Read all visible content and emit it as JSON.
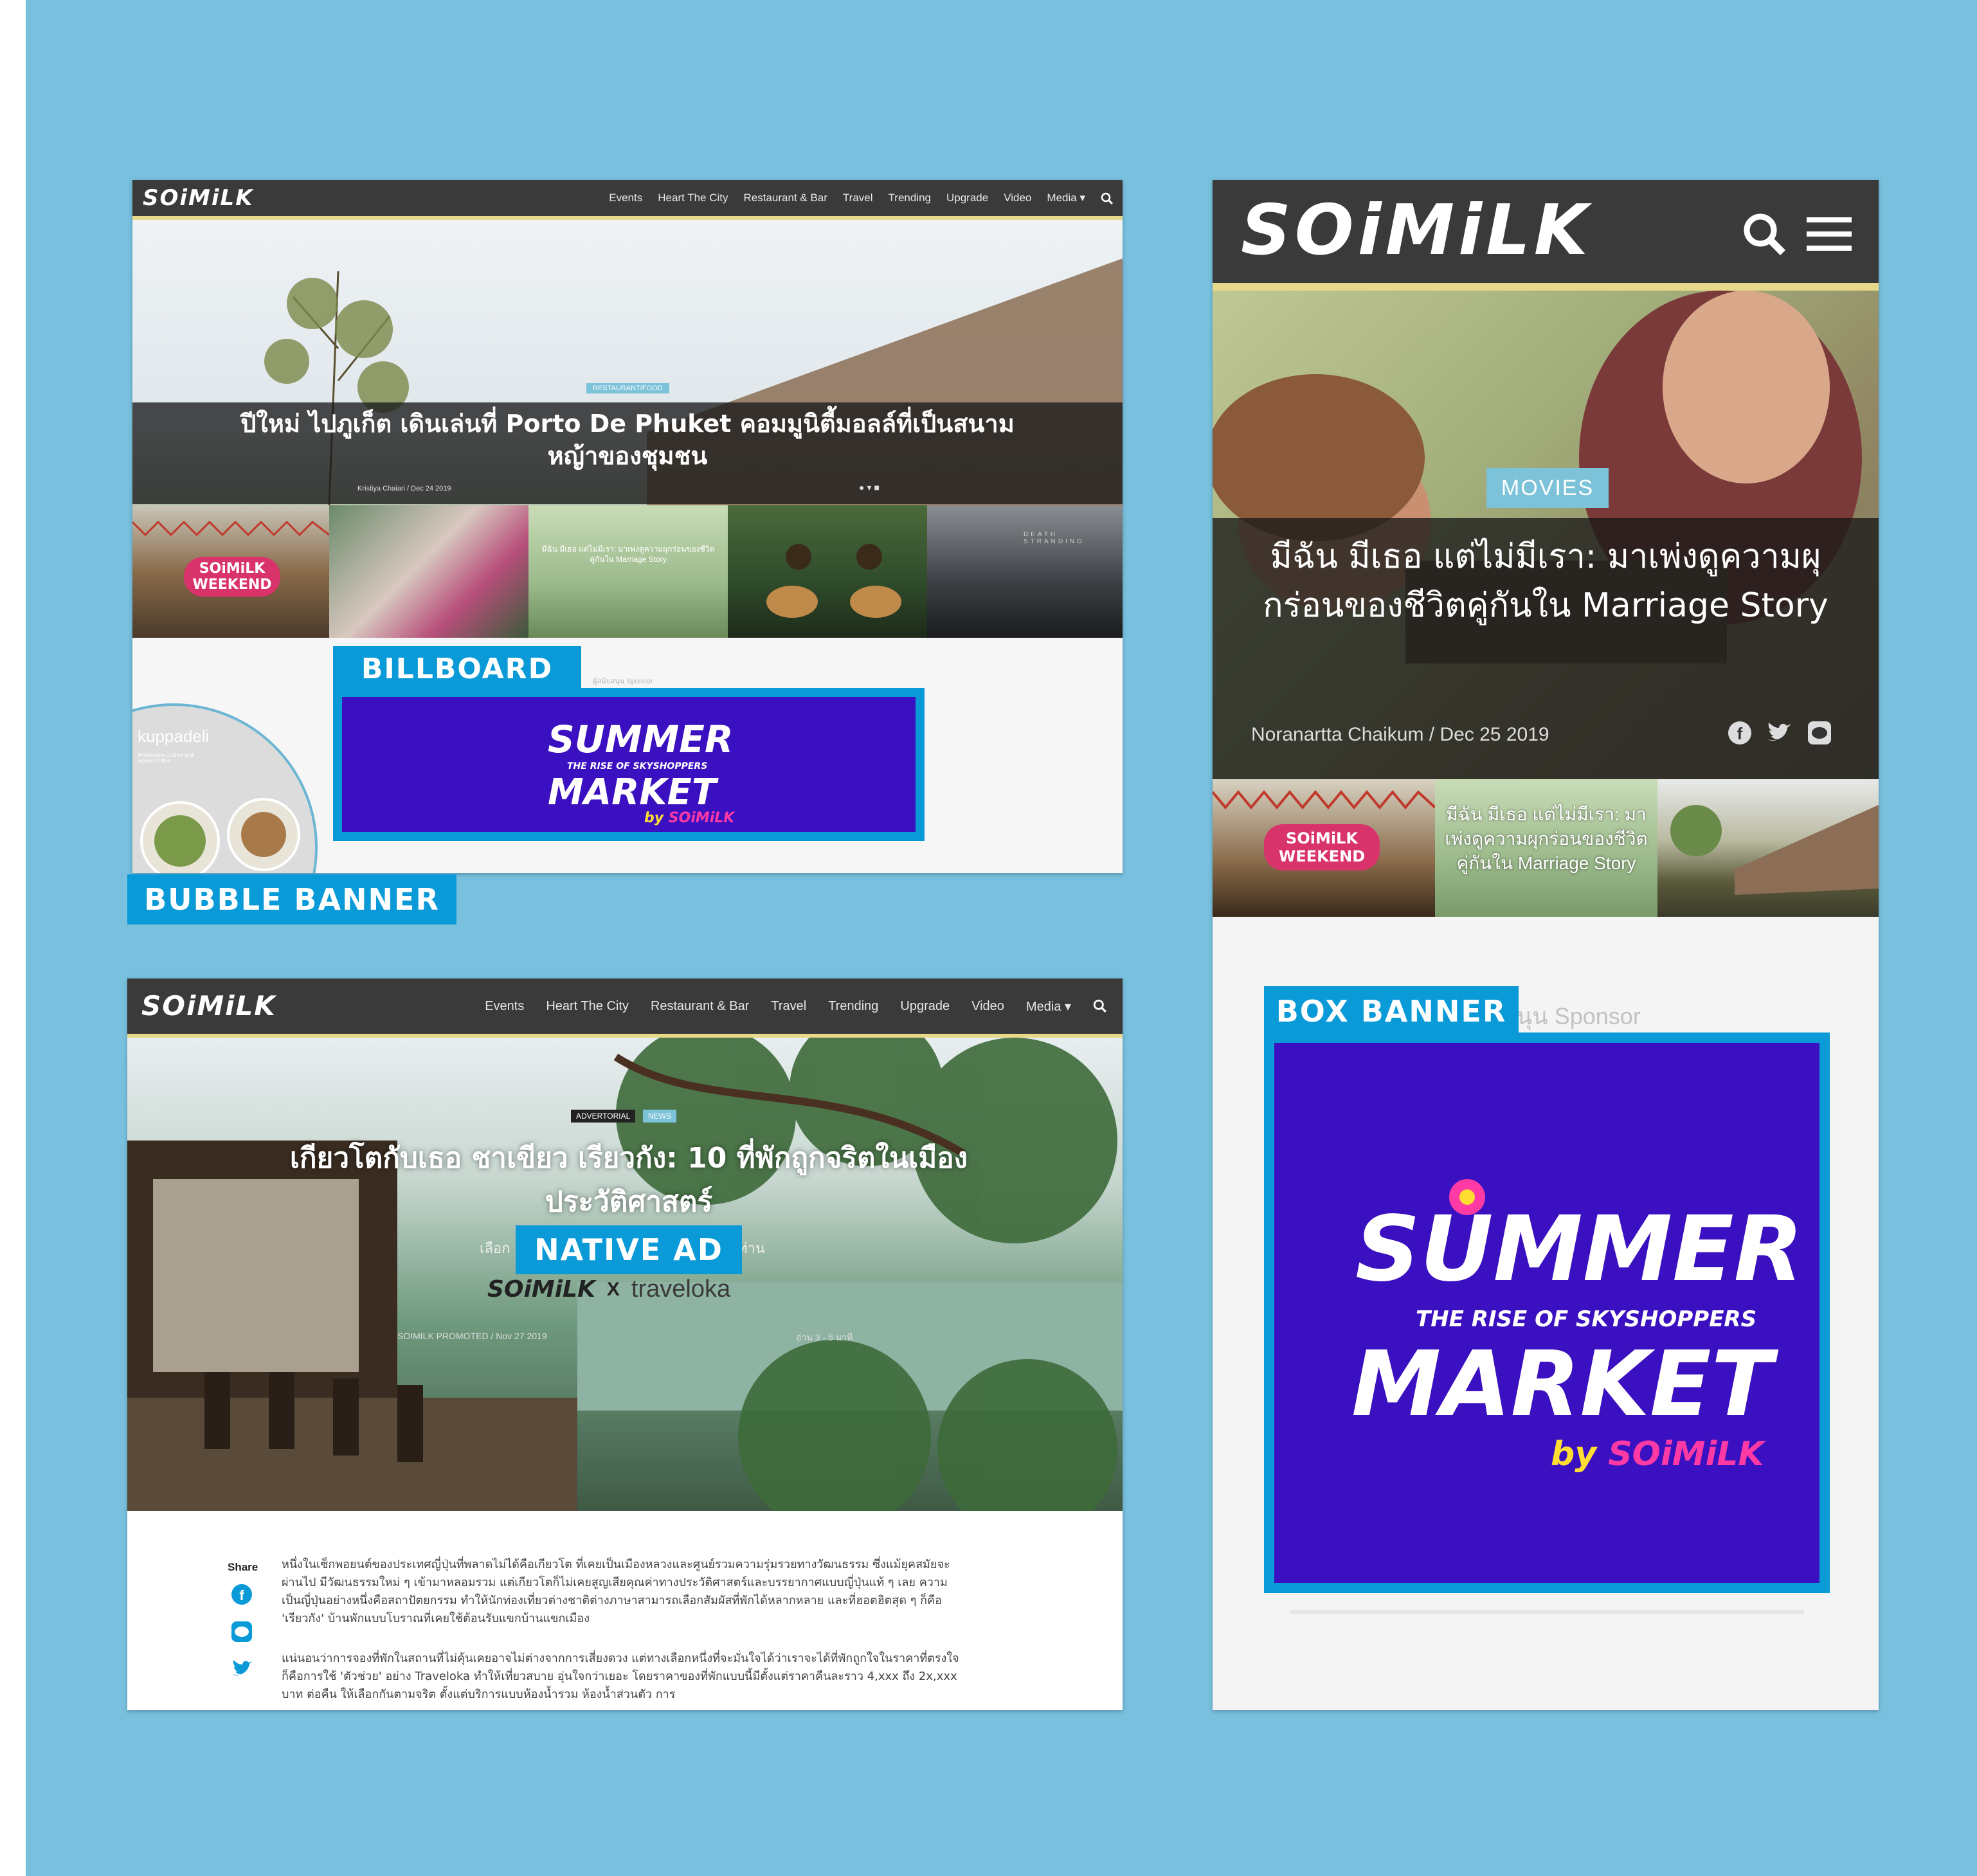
{
  "colors": {
    "background": "#78c0de",
    "tag": "#0a9ad8",
    "banner": "#3b10c0",
    "nav": "#3a3a3a",
    "accent_line": "#e8d98a"
  },
  "labels": {
    "billboard": "BILLBOARD",
    "bubble_banner": "BUBBLE BANNER",
    "native_ad": "NATIVE AD",
    "box_banner": "BOX BANNER"
  },
  "nav": {
    "logo": "SOiMiLK",
    "items": [
      "Events",
      "Heart The City",
      "Restaurant & Bar",
      "Travel",
      "Trending",
      "Upgrade",
      "Video",
      "Media"
    ],
    "icons": [
      "chevron-down-icon",
      "search-icon"
    ]
  },
  "desktop_top": {
    "category": "RESTAURANT/FOOD",
    "headline": "ปีใหม่ ไปภูเก็ต เดินเล่นที่ Porto De Phuket คอมมูนิตี้มอลล์ที่เป็นสนามหญ้าของชุมชน",
    "byline": "Kristiya Chaiari / Dec 24 2019",
    "sponsor_label": "ผู้สนับสนุน Sponsor",
    "thumbs": [
      {
        "label": "SOiMiLK WEEKEND"
      },
      {
        "label": ""
      },
      {
        "label": "มีฉัน มีเธอ แต่ไม่มีเรา: มาเพ่งดูความผุกร่อนของชีวิตคู่กันใน Marriage Story"
      },
      {
        "label": ""
      },
      {
        "label": "DEATH STRANDING"
      }
    ],
    "bubble": {
      "title": "kuppadeli",
      "subtitle": "Wholesome Cuisine and Artisan Coffee"
    }
  },
  "summer_market": {
    "line1": "SUMMER",
    "line2": "THE RISE OF SKYSHOPPERS",
    "line3": "MARKET",
    "by": "by",
    "brand": "SOiMiLK"
  },
  "native": {
    "tags": [
      "ADVERTORIAL",
      "NEWS"
    ],
    "headline": "เกียวโตกับเธอ ชาเขียว เรียวกัง: 10 ที่พักถูกจริตในเมืองประวัติศาสตร์",
    "deck_left": "เลือก",
    "deck_right": "ท่าน",
    "partner_left": "SOiMiLK",
    "partner_x": "X",
    "partner_right": "traveloka",
    "byline": "SOIMILK PROMOTED / Nov 27 2019",
    "readtime": "อ่าน 3 - 5 นาที",
    "share": "Share",
    "paragraph1": "หนึ่งในเซ็กพอยนต์ของประเทศญี่ปุ่นที่พลาดไม่ได้คือเกียวโต ที่เคยเป็นเมืองหลวงและศูนย์รวมความรุ่มรวยทางวัฒนธรรม ซึ่งแม้ยุคสมัยจะผ่านไป มีวัฒนธรรมใหม่ ๆ เข้ามาหลอมรวม แต่เกียวโตก็ไม่เคยสูญเสียคุณค่าทางประวัติศาสตร์และบรรยากาศแบบญี่ปุ่นแท้ ๆ เลย ความเป็นญี่ปุ่นอย่างหนึ่งคือสถาปัตยกรรม ทำให้นักท่องเที่ยวต่างชาติต่างภาษาสามารถเลือกสัมผัสที่พักได้หลากหลาย และที่ฮอตฮิตสุด ๆ ก็คือ 'เรียวกัง' บ้านพักแบบโบราณที่เคยใช้ต้อนรับแขกบ้านแขกเมือง",
    "paragraph2": "แน่นอนว่าการจองที่พักในสถานที่ไม่คุ้นเคยอาจไม่ต่างจากการเสี่ยงดวง แต่ทางเลือกหนึ่งที่จะมั่นใจได้ว่าเราจะได้ที่พักถูกใจในราคาที่ตรงใจก็คือการใช้ 'ตัวช่วย' อย่าง Traveloka ทำให้เที่ยวสบาย อุ่นใจกว่าเยอะ โดยราคาของที่พักแบบนี้มีตั้งแต่ราคาคืนละราว 4,xxx ถึง 2x,xxx บาท ต่อคืน ให้เลือกกันตามจริต ตั้งแต่บริการแบบห้องน้ำรวม ห้องน้ำส่วนตัว การ"
  },
  "mobile": {
    "category": "MOVIES",
    "headline": "มีฉัน มีเธอ แต่ไม่มีเรา: มาเพ่งดูความผุกร่อนของชีวิตคู่กันใน Marriage Story",
    "byline": "Noranartta Chaikum / Dec 25 2019",
    "thumb_mid": "มีฉัน มีเธอ แต่ไม่มีเรา: มาเพ่งดูความผุกร่อนของชีวิตคู่กันใน Marriage Story",
    "thumb_left": "SOiMiLK WEEKEND",
    "sponsor_label": "ผู้สนับสนุน Sponsor"
  }
}
